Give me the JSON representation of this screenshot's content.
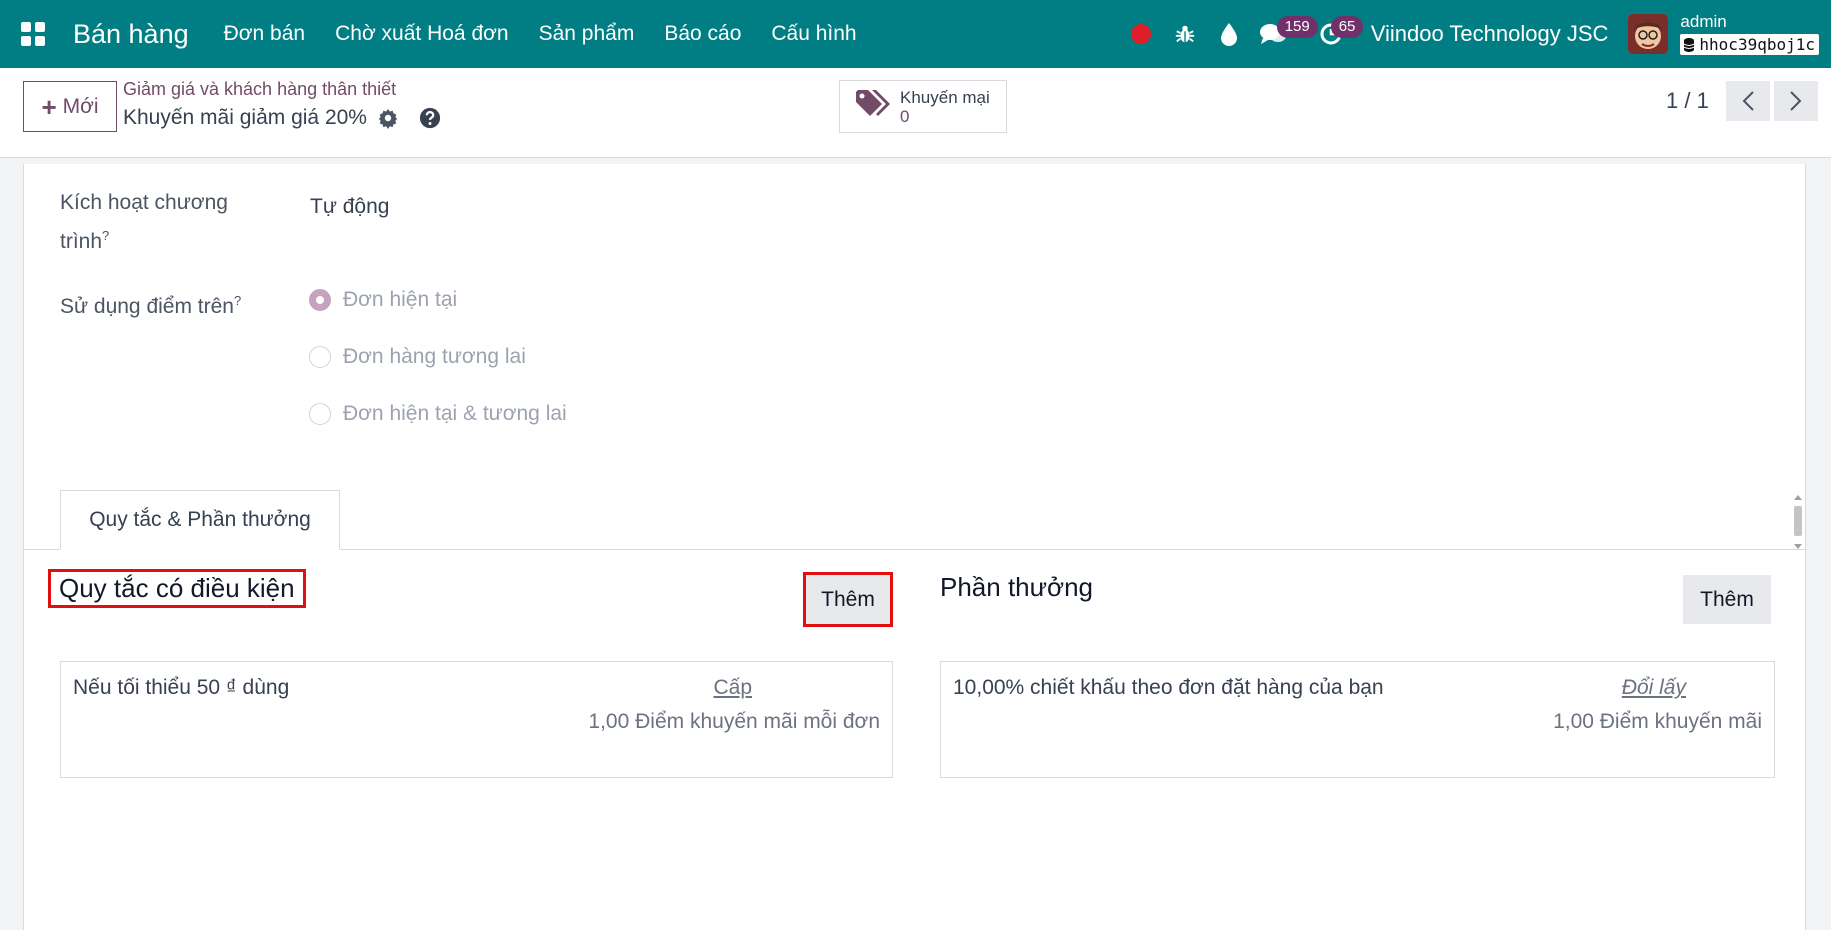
{
  "navbar": {
    "app_title": "Bán hàng",
    "menu": [
      "Đơn bán",
      "Chờ xuất Hoá đơn",
      "Sản phẩm",
      "Báo cáo",
      "Cấu hình"
    ],
    "messages_count": "159",
    "activities_count": "65",
    "company": "Viindoo Technology JSC",
    "user": "admin",
    "database": "hhoc39qboj1c"
  },
  "control": {
    "new_label": "Mới",
    "breadcrumb_parent": "Giảm giá và khách hàng thân thiết",
    "breadcrumb_current": "Khuyến mãi giảm giá 20%",
    "smart_button": {
      "label": "Khuyến mại",
      "value": "0"
    },
    "pager": "1 / 1"
  },
  "form": {
    "trigger_label": "Kích hoạt chương trình",
    "trigger_label_line1": "Kích hoạt chương",
    "trigger_label_line2": "trình",
    "trigger_value": "Tự động",
    "use_points_label": "Sử dụng điểm trên",
    "use_points_options": [
      "Đơn hiện tại",
      "Đơn hàng tương lai",
      "Đơn hiện tại & tương lai"
    ],
    "use_points_selected": "Đơn hiện tại"
  },
  "tabs": [
    "Quy tắc & Phần thưởng"
  ],
  "rules": {
    "title": "Quy tắc có điều kiện",
    "add_label": "Thêm",
    "card": {
      "main": "Nếu tối thiểu 50 ₫ dùng",
      "link": "Cấp",
      "sub": "1,00 Điểm khuyến mãi mỗi đơn"
    }
  },
  "rewards": {
    "title": "Phần thưởng",
    "add_label": "Thêm",
    "card": {
      "main": "10,00% chiết khấu theo đơn đặt hàng của bạn",
      "link": "Đổi lấy",
      "sub": "1,00 Điểm khuyến mãi"
    }
  },
  "colors": {
    "navbar": "#017e84",
    "primary": "#714b67",
    "highlight": "#e11010",
    "badge": "#71306a"
  }
}
